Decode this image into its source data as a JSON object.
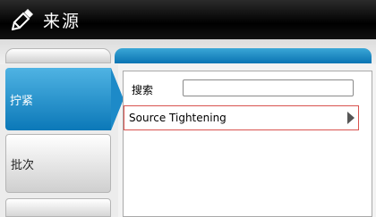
{
  "header": {
    "title": "来源",
    "icon": "pencil-ruler-icon"
  },
  "sidebar": {
    "items": [
      {
        "label": "拧紧",
        "active": true
      },
      {
        "label": "批次",
        "active": false
      },
      {
        "label": "",
        "active": false
      }
    ]
  },
  "main": {
    "search": {
      "label": "搜索",
      "value": "",
      "placeholder": ""
    },
    "list": [
      {
        "label": "Source Tightening",
        "icon": "chevron-right-icon"
      }
    ]
  },
  "colors": {
    "accent": "#0b78b8",
    "highlight_border": "#d9534f",
    "titlebar": "#000000"
  }
}
